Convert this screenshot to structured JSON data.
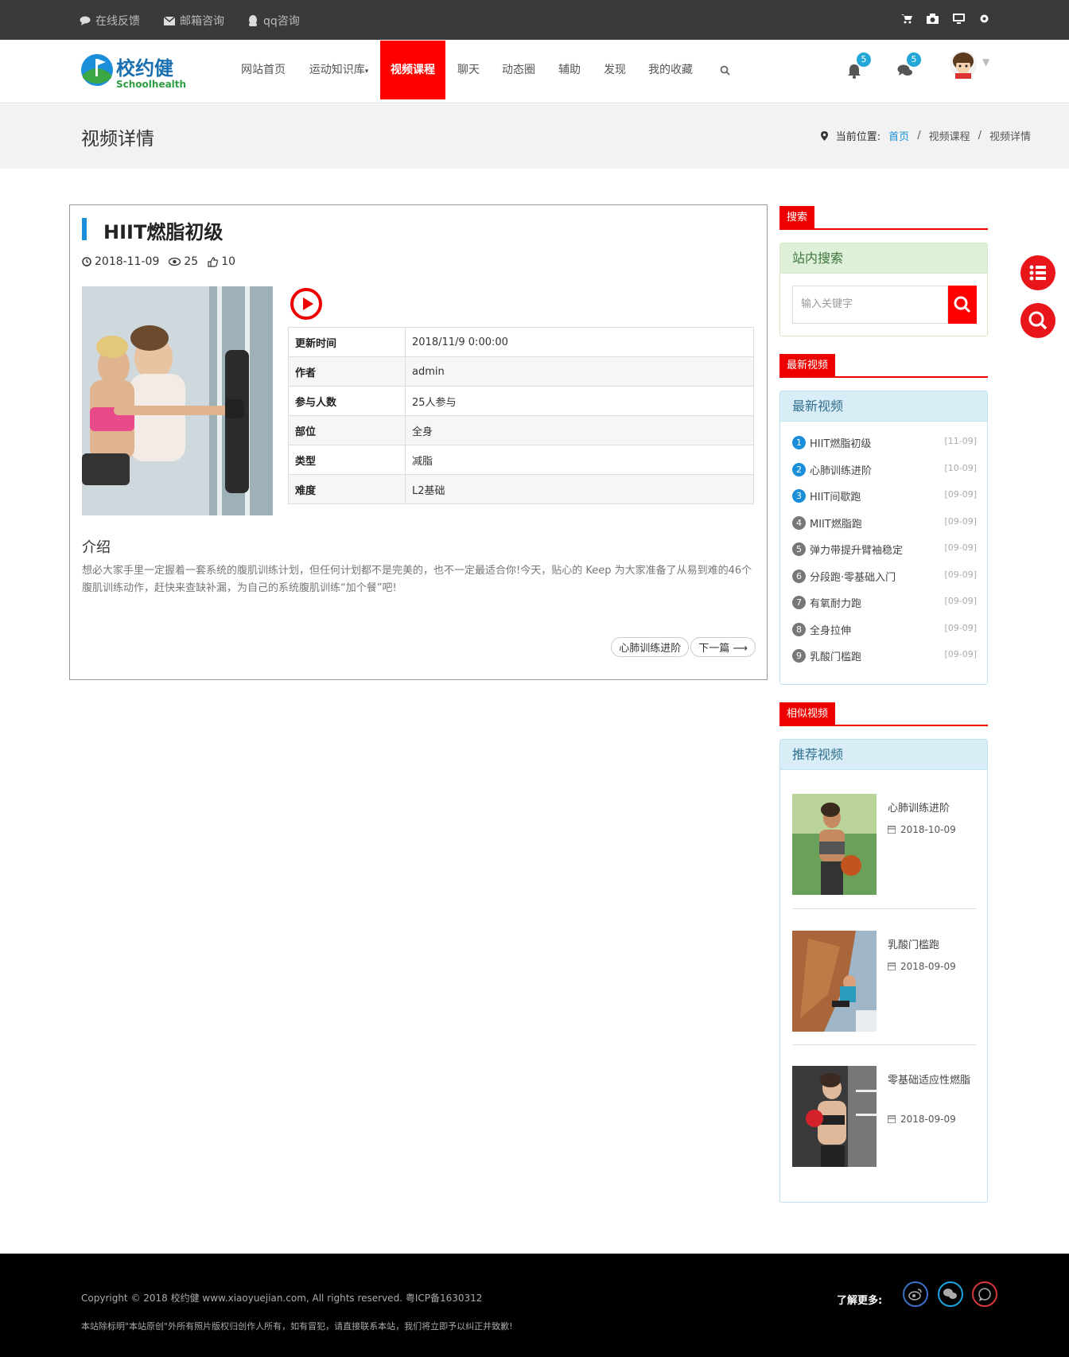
{
  "topbar": {
    "links": [
      "在线反馈",
      "邮箱咨询",
      "qq咨询"
    ],
    "icons": [
      "cart-icon",
      "camera-icon",
      "monitor-icon",
      "gear-icon"
    ]
  },
  "logo": {
    "name": "校约健",
    "sub": "Schoolhealth"
  },
  "nav": {
    "items": [
      "网站首页",
      "运动知识库",
      "视频课程",
      "聊天",
      "动态圈",
      "辅助",
      "发现",
      "我的收藏"
    ],
    "active": "视频课程",
    "notify_count": "5",
    "message_count": "5"
  },
  "page": {
    "heading": "视频详情",
    "crumb_label": "当前位置:",
    "crumbs": [
      "首页",
      "视频课程",
      "视频详情"
    ]
  },
  "video": {
    "title": "HIIT燃脂初级",
    "date": "2018-11-09",
    "views": "25",
    "likes": "10",
    "rows": [
      {
        "k": "更新时间",
        "v": "2018/11/9 0:00:00"
      },
      {
        "k": "作者",
        "v": "admin"
      },
      {
        "k": "参与人数",
        "v": "25人参与"
      },
      {
        "k": "部位",
        "v": "全身"
      },
      {
        "k": "类型",
        "v": "减脂"
      },
      {
        "k": "难度",
        "v": "L2基础"
      }
    ],
    "intro_heading": "介绍",
    "intro": "想必大家手里一定握着一套系统的腹肌训练计划，但任何计划都不是完美的，也不一定最适合你!今天，贴心的 Keep 为大家准备了从易到难的46个腹肌训练动作，赶快来查缺补漏，为自己的系统腹肌训练“加个餐”吧!",
    "prev": "心肺训练进阶",
    "next": "下一篇"
  },
  "sidebar": {
    "search_tab": "搜索",
    "search_heading": "站内搜索",
    "search_placeholder": "输入关键字",
    "latest_tab": "最新视频",
    "latest_heading": "最新视频",
    "latest": [
      {
        "n": "1",
        "t": "HIIT燃脂初级",
        "d": "[11-09]",
        "c": "#1a8ed8"
      },
      {
        "n": "2",
        "t": "心肺训练进阶",
        "d": "[10-09]",
        "c": "#1a8ed8"
      },
      {
        "n": "3",
        "t": "HIIT间歇跑",
        "d": "[09-09]",
        "c": "#1a8ed8"
      },
      {
        "n": "4",
        "t": "MIIT燃脂跑",
        "d": "[09-09]",
        "c": "#777"
      },
      {
        "n": "5",
        "t": "弹力带提升臂袖稳定",
        "d": "[09-09]",
        "c": "#777"
      },
      {
        "n": "6",
        "t": "分段跑·零基础入门",
        "d": "[09-09]",
        "c": "#777"
      },
      {
        "n": "7",
        "t": "有氧耐力跑",
        "d": "[09-09]",
        "c": "#777"
      },
      {
        "n": "8",
        "t": "全身拉伸",
        "d": "[09-09]",
        "c": "#777"
      },
      {
        "n": "9",
        "t": "乳酸门槛跑",
        "d": "[09-09]",
        "c": "#777"
      }
    ],
    "similar_tab": "相似视频",
    "rec_heading": "推荐视频",
    "recommended": [
      {
        "t": "心肺训练进阶",
        "d": "2018-10-09"
      },
      {
        "t": "乳酸门槛跑",
        "d": "2018-09-09"
      },
      {
        "t": "零基础适应性燃脂",
        "d": "2018-09-09"
      }
    ]
  },
  "footer": {
    "copyright": "Copyright © 2018 校约健 www.xiaoyuejian.com, All rights reserved. 粤ICP备1630312",
    "notice": "本站除标明\"本站原创\"外所有照片版权归创作人所有，如有冒犯，请直接联系本站，我们将立即予以纠正并致歉!",
    "more": "了解更多:"
  }
}
